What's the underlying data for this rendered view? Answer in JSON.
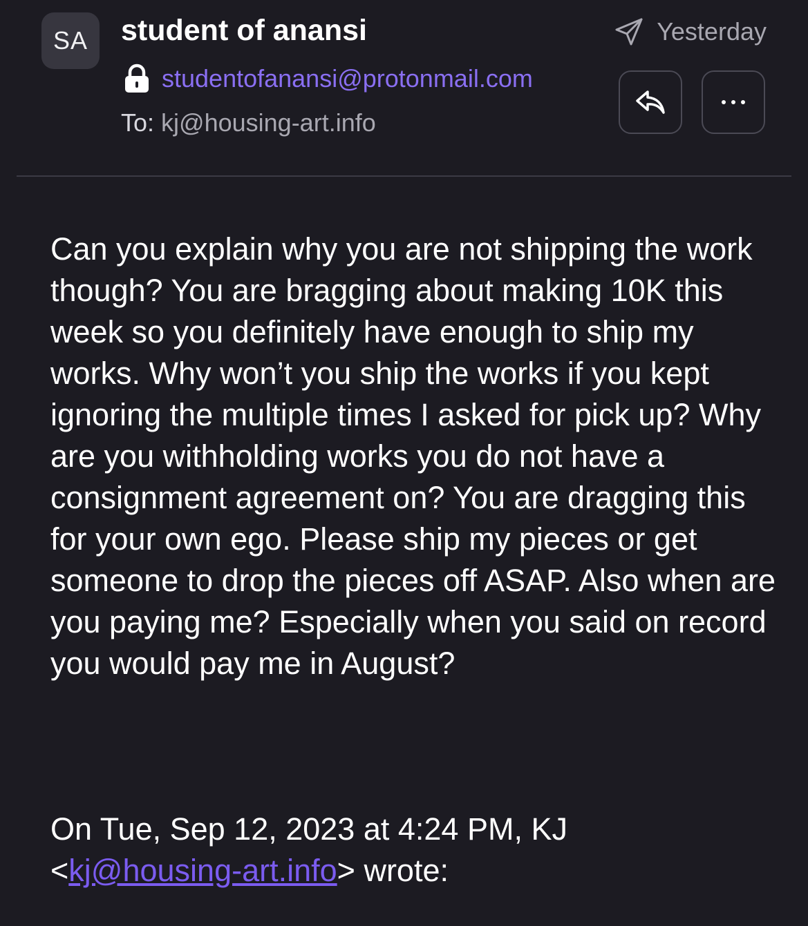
{
  "sender": {
    "initials": "SA",
    "name": "student of anansi",
    "email": "studentofanansi@protonmail.com"
  },
  "recipient": {
    "label": "To:",
    "email": "kj@housing-art.info"
  },
  "date": "Yesterday",
  "icons": {
    "lock": "lock-icon",
    "send": "paper-plane-icon",
    "reply": "reply-icon",
    "more": "more-icon"
  },
  "colors": {
    "background": "#1c1b22",
    "accent": "#8a6ff2",
    "link": "#7b5cf0"
  },
  "body": "Can you explain why you are not shipping the work though? You are bragging about making 10K this week so you definitely have enough to ship my works. Why won’t you ship the works if you kept ignoring the multiple times I asked for pick up? Why are you withholding works you do not have a consignment agreement on? You are dragging this for your own ego. Please ship my pieces or get someone to drop the pieces off ASAP. Also when are you paying me? Especially when you said on record you would pay me in August?",
  "quote": {
    "intro": "On Tue, Sep 12, 2023 at 4:24 PM, KJ",
    "open": "<",
    "link": "kj@housing-art.info",
    "close": ">",
    "suffix": " wrote:"
  }
}
